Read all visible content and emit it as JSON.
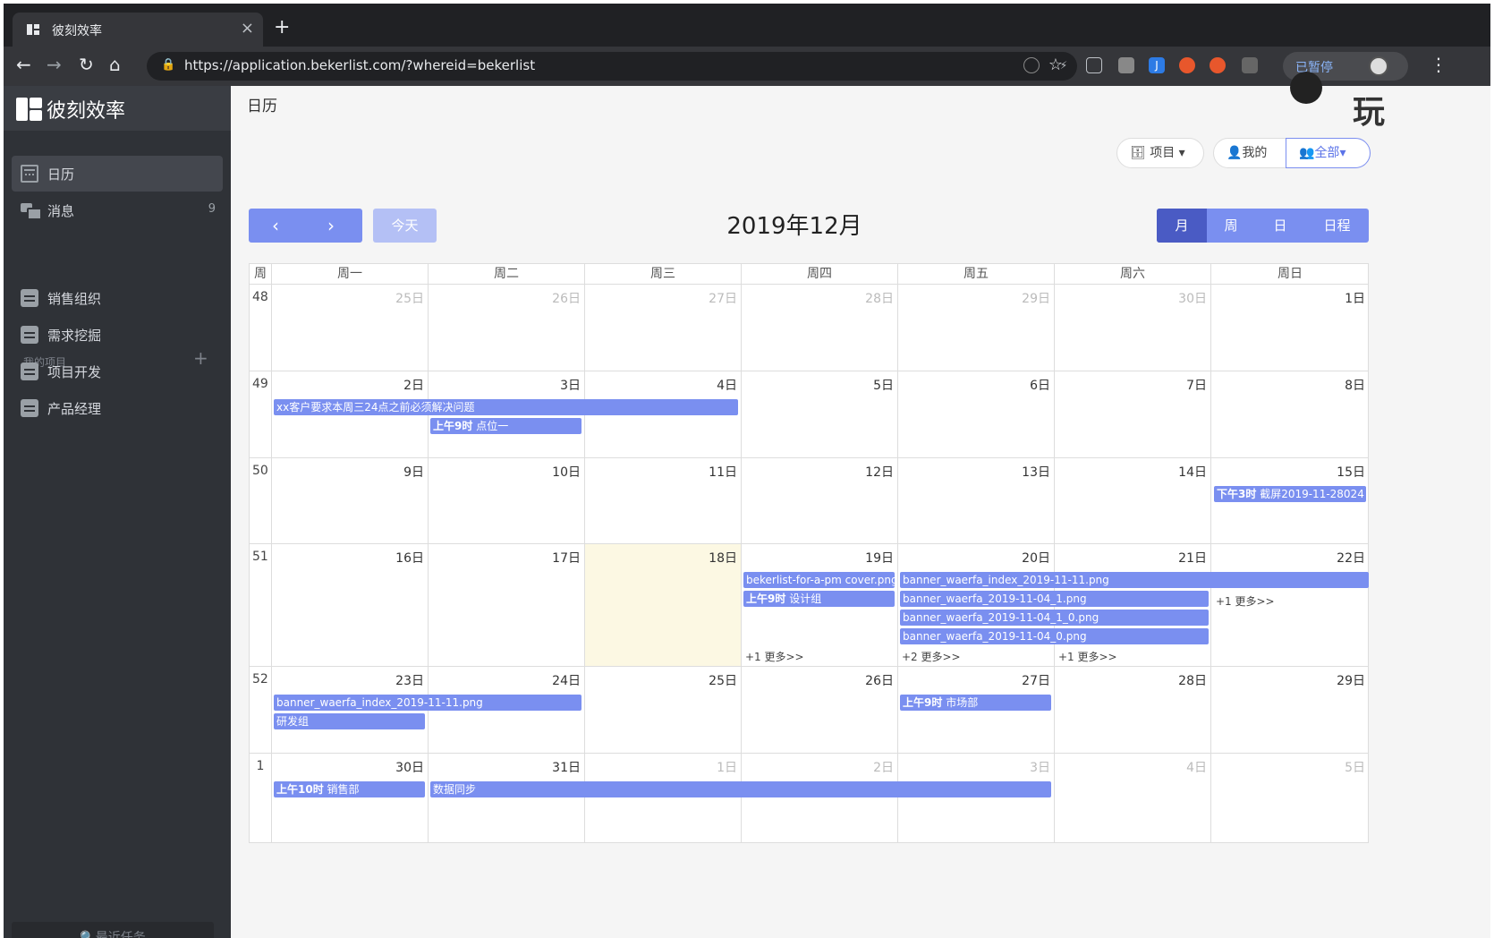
{
  "browser": {
    "tab_title": "彼刻效率",
    "url": "https://application.bekerlist.com/?whereid=bekerlist",
    "paused_label": "已暂停"
  },
  "sidebar": {
    "brand": "彼刻效率",
    "nav": [
      {
        "label": "日历",
        "count": ""
      },
      {
        "label": "消息",
        "count": "9"
      }
    ],
    "section_label": "我的项目",
    "projects": [
      "销售组织",
      "需求挖掘",
      "项目开发",
      "产品经理"
    ],
    "recent": "🔍最近任务"
  },
  "main": {
    "page_title": "日历",
    "deco_text": "玩",
    "filters": {
      "project": "项目",
      "mine": "我的",
      "all": "全部"
    },
    "today": "今天",
    "title": "2019年12月",
    "views": [
      "月",
      "周",
      "日",
      "日程"
    ],
    "week_col": "周",
    "weekdays": [
      "周一",
      "周二",
      "周三",
      "周四",
      "周五",
      "周六",
      "周日"
    ],
    "weeks": [
      {
        "num": "48",
        "days": [
          "25日",
          "26日",
          "27日",
          "28日",
          "29日",
          "30日",
          "1日"
        ]
      },
      {
        "num": "49",
        "days": [
          "2日",
          "3日",
          "4日",
          "5日",
          "6日",
          "7日",
          "8日"
        ]
      },
      {
        "num": "50",
        "days": [
          "9日",
          "10日",
          "11日",
          "12日",
          "13日",
          "14日",
          "15日"
        ]
      },
      {
        "num": "51",
        "days": [
          "16日",
          "17日",
          "18日",
          "19日",
          "20日",
          "21日",
          "22日"
        ]
      },
      {
        "num": "52",
        "days": [
          "23日",
          "24日",
          "25日",
          "26日",
          "27日",
          "28日",
          "29日"
        ]
      },
      {
        "num": "1",
        "days": [
          "30日",
          "31日",
          "1日",
          "2日",
          "3日",
          "4日",
          "5日"
        ]
      }
    ],
    "events": {
      "e1": "xx客户要求本周三24点之前必须解决问题",
      "e2_time": "上午9时",
      "e2": "点位一",
      "e3_time": "下午3时",
      "e3": "截屏2019-11-28024",
      "e4": "bekerlist-for-a-pm cover.png",
      "e5_time": "上午9时",
      "e5": "设计组",
      "e6": "banner_waerfa_index_2019-11-11.png",
      "e7": "banner_waerfa_2019-11-04_1.png",
      "e8": "banner_waerfa_2019-11-04_1_0.png",
      "e9": "banner_waerfa_2019-11-04_0.png",
      "more_thu": "+1 更多>>",
      "more_fri": "+2 更多>>",
      "more_sat": "+1 更多>>",
      "more_sun": "+1 更多>>",
      "e10": "banner_waerfa_index_2019-11-11.png",
      "e11": "研发组",
      "e12_time": "上午9时",
      "e12": "市场部",
      "e13_time": "上午10时",
      "e13": "销售部",
      "e14": "数据同步"
    }
  },
  "colors": {
    "accent": "#7a8ff0",
    "accent_dark": "#4a5bc4",
    "today_bg": "#fcf8e3",
    "sidebar": "#2f3237"
  }
}
